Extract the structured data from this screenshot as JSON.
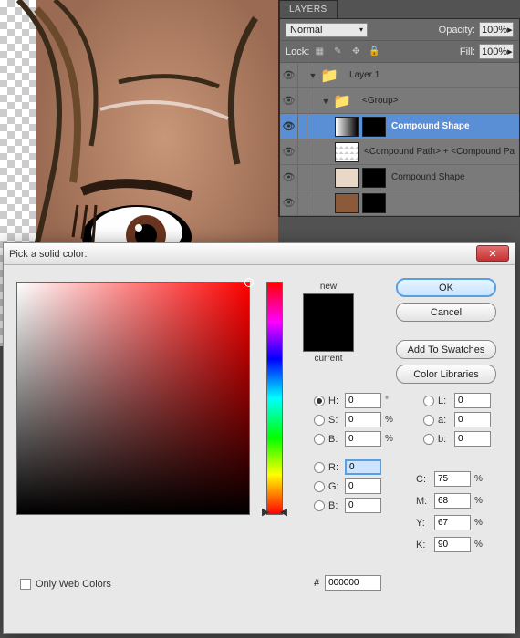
{
  "layers_panel": {
    "tab_label": "LAYERS",
    "blend_mode": "Normal",
    "opacity_label": "Opacity:",
    "opacity_value": "100%",
    "lock_label": "Lock:",
    "fill_label": "Fill:",
    "fill_value": "100%",
    "items": [
      {
        "name": "Layer 1",
        "type": "group",
        "indent": 0,
        "selected": false
      },
      {
        "name": "<Group>",
        "type": "group",
        "indent": 1,
        "selected": false
      },
      {
        "name": "Compound Shape",
        "type": "shape",
        "indent": 2,
        "selected": true
      },
      {
        "name": "<Compound Path> + <Compound Pa",
        "type": "shape",
        "indent": 2,
        "selected": false
      },
      {
        "name": "Compound Shape",
        "type": "shape",
        "indent": 2,
        "selected": false
      }
    ]
  },
  "color_picker": {
    "title": "Pick a solid color:",
    "new_label": "new",
    "current_label": "current",
    "buttons": {
      "ok": "OK",
      "cancel": "Cancel",
      "add_swatch": "Add To Swatches",
      "libraries": "Color Libraries"
    },
    "hsb": {
      "h_label": "H:",
      "h": "0",
      "h_unit": "°",
      "s_label": "S:",
      "s": "0",
      "s_unit": "%",
      "b_label": "B:",
      "b": "0",
      "b_unit": "%"
    },
    "lab": {
      "l_label": "L:",
      "l": "0",
      "a_label": "a:",
      "a": "0",
      "b_label": "b:",
      "b": "0"
    },
    "rgb": {
      "r_label": "R:",
      "r": "0",
      "g_label": "G:",
      "g": "0",
      "b_label": "B:",
      "b": "0"
    },
    "cmyk": {
      "c_label": "C:",
      "c": "75",
      "m_label": "M:",
      "m": "68",
      "y_label": "Y:",
      "y": "67",
      "k_label": "K:",
      "k": "90",
      "unit": "%"
    },
    "hex_label": "#",
    "hex": "000000",
    "web_only_label": "Only Web Colors"
  }
}
